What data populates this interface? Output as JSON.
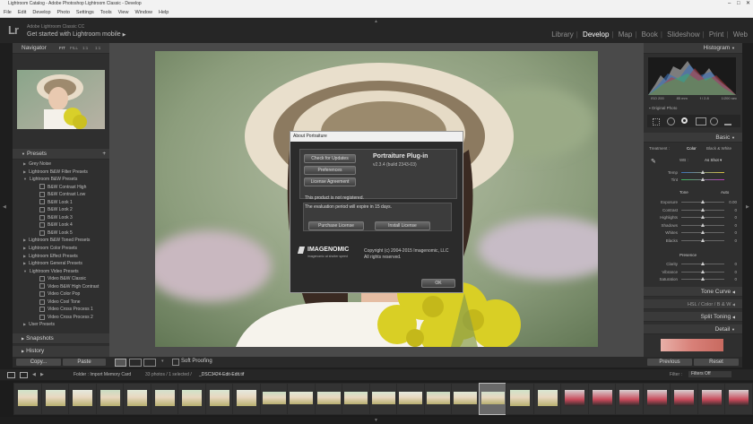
{
  "window": {
    "title": "Lightroom Catalog - Adobe Photoshop Lightroom Classic - Develop"
  },
  "menu": [
    "File",
    "Edit",
    "Develop",
    "Photo",
    "Settings",
    "Tools",
    "View",
    "Window",
    "Help"
  ],
  "identity": {
    "logo": "Lr",
    "product": "Adobe Lightroom Classic CC",
    "mobile_prompt": "Get started with Lightroom mobile"
  },
  "modules": [
    {
      "label": "Library",
      "active": false
    },
    {
      "label": "Develop",
      "active": true
    },
    {
      "label": "Map",
      "active": false
    },
    {
      "label": "Book",
      "active": false
    },
    {
      "label": "Slideshow",
      "active": false
    },
    {
      "label": "Print",
      "active": false
    },
    {
      "label": "Web",
      "active": false
    }
  ],
  "left": {
    "navigator": {
      "title": "Navigator",
      "zoom": [
        "FIT",
        "FILL",
        "1:1",
        "1:1"
      ]
    },
    "presets": {
      "title": "Presets",
      "items": [
        {
          "label": "Grey Noise",
          "type": "folder",
          "open": false
        },
        {
          "label": "Lightroom B&W Filter Presets",
          "type": "folder",
          "open": false
        },
        {
          "label": "Lightroom B&W Presets",
          "type": "folder",
          "open": true
        },
        {
          "label": "B&W Contrast High",
          "type": "item"
        },
        {
          "label": "B&W Contrast Low",
          "type": "item"
        },
        {
          "label": "B&W Look 1",
          "type": "item"
        },
        {
          "label": "B&W Look 2",
          "type": "item"
        },
        {
          "label": "B&W Look 3",
          "type": "item"
        },
        {
          "label": "B&W Look 4",
          "type": "item"
        },
        {
          "label": "B&W Look 5",
          "type": "item"
        },
        {
          "label": "Lightroom B&W Toned Presets",
          "type": "folder",
          "open": false
        },
        {
          "label": "Lightroom Color Presets",
          "type": "folder",
          "open": false
        },
        {
          "label": "Lightroom Effect Presets",
          "type": "folder",
          "open": false
        },
        {
          "label": "Lightroom General Presets",
          "type": "folder",
          "open": false
        },
        {
          "label": "Lightroom Video Presets",
          "type": "folder",
          "open": true
        },
        {
          "label": "Video B&W Classic",
          "type": "item"
        },
        {
          "label": "Video B&W High Contrast",
          "type": "item"
        },
        {
          "label": "Video Color Pop",
          "type": "item"
        },
        {
          "label": "Video Cool Tone",
          "type": "item"
        },
        {
          "label": "Video Cross Process 1",
          "type": "item"
        },
        {
          "label": "Video Cross Process 2",
          "type": "item"
        },
        {
          "label": "User Presets",
          "type": "folder",
          "open": false
        }
      ]
    },
    "snapshots": "Snapshots",
    "history": "History",
    "copy": "Copy...",
    "paste": "Paste"
  },
  "dialog": {
    "title": "About Portraiture",
    "buttons": [
      "Check for Updates",
      "Preferences",
      "License Agreement"
    ],
    "plugin_name": "Portraiture Plug-in",
    "version": "v2.3.4 (build 2343-03)",
    "not_registered": "This product is not registered.",
    "expire": "The evaluation period will expire in 15 days.",
    "purchase": "Purchase License",
    "install": "Install License",
    "brand": "IMAGENOMIC",
    "tagline": "imagenomic at shutter speed",
    "copyright": "Copyright (c) 2004-2015 Imagenomic, LLC",
    "rights": "All rights reserved.",
    "ok": "OK"
  },
  "toolbar": {
    "soft_proofing": "Soft Proofing"
  },
  "right": {
    "histogram": "Histogram",
    "histo_info": [
      "ISO 200",
      "85 mm",
      "f / 2.8",
      "1/200 sec"
    ],
    "original_photo": "Original Photo",
    "basic": "Basic",
    "treatment": "Treatment :",
    "color": "Color",
    "bw": "Black & White",
    "wb": "WB :",
    "as_shot": "As Shot",
    "temp": "Temp",
    "tint": "Tint",
    "tone": "Tone",
    "auto": "Auto",
    "tone_sliders": [
      {
        "label": "Exposure",
        "value": "0.00"
      },
      {
        "label": "Contrast",
        "value": "0"
      },
      {
        "label": "Highlights",
        "value": "0"
      },
      {
        "label": "Shadows",
        "value": "0"
      },
      {
        "label": "Whites",
        "value": "0"
      },
      {
        "label": "Blacks",
        "value": "0"
      }
    ],
    "presence": "Presence",
    "presence_sliders": [
      {
        "label": "Clarity",
        "value": "0"
      },
      {
        "label": "Vibrance",
        "value": "0"
      },
      {
        "label": "Saturation",
        "value": "0"
      }
    ],
    "tone_curve": "Tone Curve",
    "hsl": "HSL",
    "color_tab": "Color",
    "bw_tab": "B & W",
    "split_toning": "Split Toning",
    "detail": "Detail",
    "previous": "Previous",
    "reset": "Reset"
  },
  "filmstrip": {
    "source": "Folder : Import Memory Card",
    "count": "33 photos / 1 selected /",
    "filename": "_DSC3424-Edit-Edit.tif",
    "filter_label": "Filter :",
    "filter_value": "Filters Off"
  }
}
